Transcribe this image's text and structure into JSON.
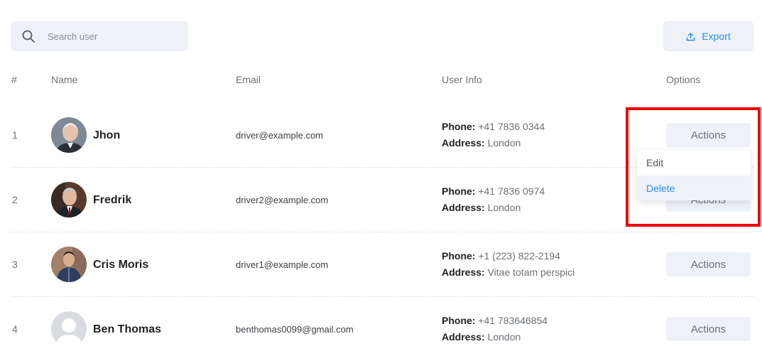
{
  "search": {
    "placeholder": "Search user",
    "icon": "search-icon"
  },
  "export": {
    "label": "Export",
    "icon": "upload-icon",
    "color": "#2d8ee8"
  },
  "table": {
    "headers": [
      "#",
      "Name",
      "Email",
      "User Info",
      "Options"
    ],
    "rows": [
      {
        "num": "1",
        "name": "Jhon",
        "email": "driver@example.com",
        "phone_label": "Phone:",
        "phone": "+41 7836 0344",
        "address_label": "Address:",
        "address": "London",
        "action": "Actions"
      },
      {
        "num": "2",
        "name": "Fredrik",
        "email": "driver2@example.com",
        "phone_label": "Phone:",
        "phone": "+41 7836 0974",
        "address_label": "Address:",
        "address": "London",
        "action": "Actions"
      },
      {
        "num": "3",
        "name": "Cris Moris",
        "email": "driver1@example.com",
        "phone_label": "Phone:",
        "phone": "+1 (223) 822-2194",
        "address_label": "Address:",
        "address": "Vitae totam perspici",
        "action": "Actions"
      },
      {
        "num": "4",
        "name": "Ben Thomas",
        "email": "benthomas0099@gmail.com",
        "phone_label": "Phone:",
        "phone": "+41 783646854",
        "address_label": "Address:",
        "address": "London",
        "action": "Actions"
      }
    ]
  },
  "dropdown": {
    "items": [
      "Edit",
      "Delete"
    ],
    "active": "Delete"
  },
  "colors": {
    "accent": "#2d8ee8",
    "highlight": "#ee0000",
    "button_bg": "#eef2f6"
  }
}
